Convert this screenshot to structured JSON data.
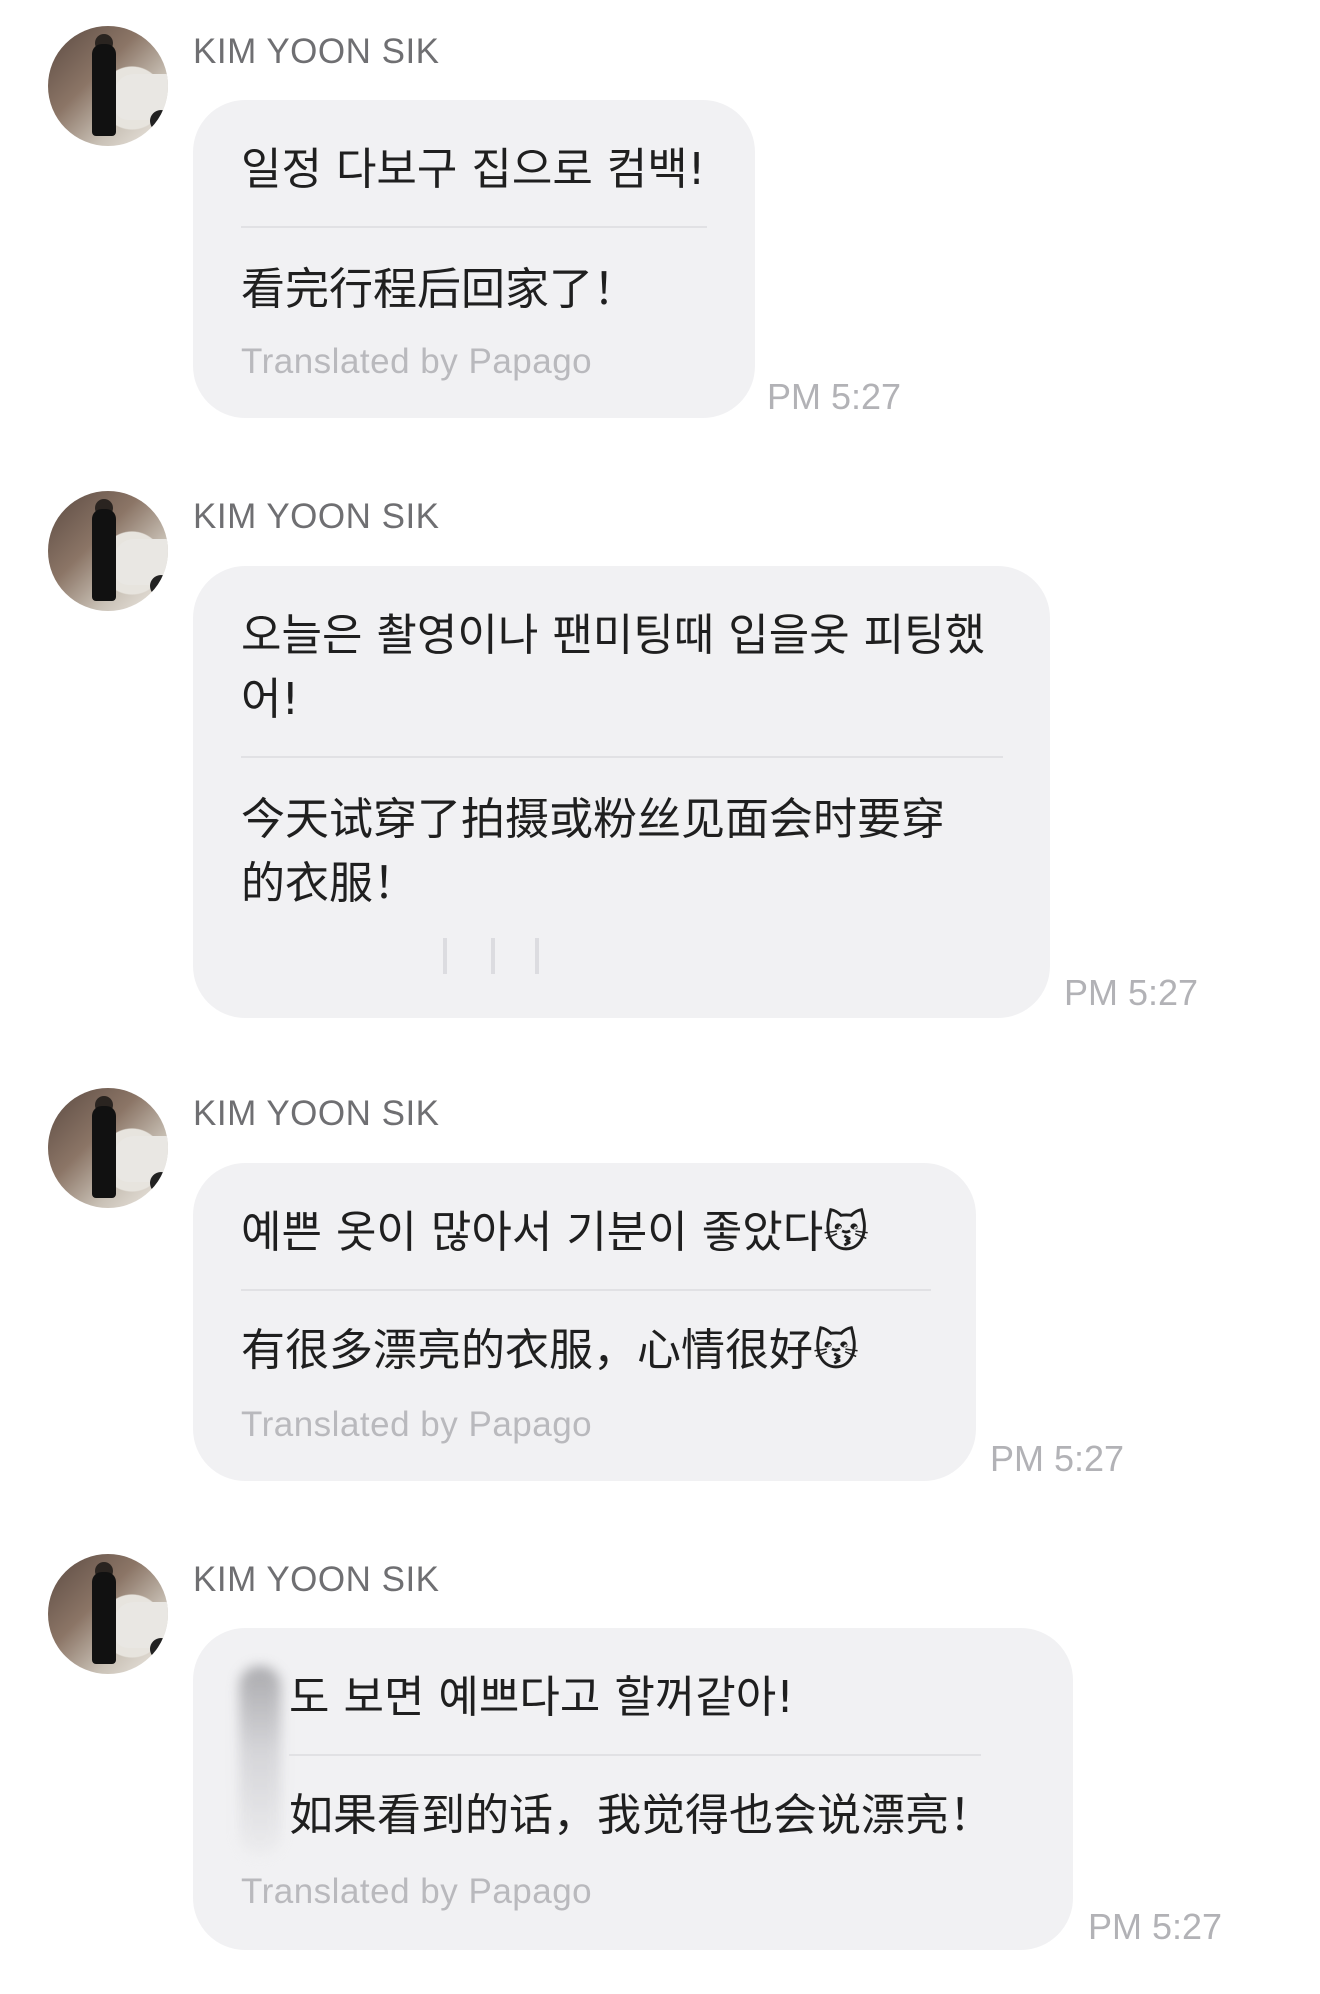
{
  "messages": [
    {
      "sender": "KIM YOON SIK",
      "original": [
        "일정 다보구 집으로 컴백!"
      ],
      "translation": [
        "看完行程后回家了！"
      ],
      "credit": "Translated by Papago",
      "time": "PM 5:27"
    },
    {
      "sender": "KIM YOON SIK",
      "original": [
        "오늘은 촬영이나 팬미팅때 입을옷 피팅했",
        "어!"
      ],
      "translation": [
        "今天试穿了拍摄或粉丝见面会时要穿",
        "的衣服！"
      ],
      "credit": "",
      "time": "PM 5:27"
    },
    {
      "sender": "KIM YOON SIK",
      "original": [
        "예쁜 옷이 많아서 기분이 좋았다😽"
      ],
      "translation": [
        "有很多漂亮的衣服，心情很好😽"
      ],
      "credit": "Translated by Papago",
      "time": "PM 5:27"
    },
    {
      "sender": "KIM YOON SIK",
      "original": [
        "도 보면 예쁘다고 할꺼같아!"
      ],
      "translation": [
        "如果看到的话，我觉得也会说漂亮！"
      ],
      "credit": "Translated by Papago",
      "time": "PM 5:27"
    }
  ]
}
